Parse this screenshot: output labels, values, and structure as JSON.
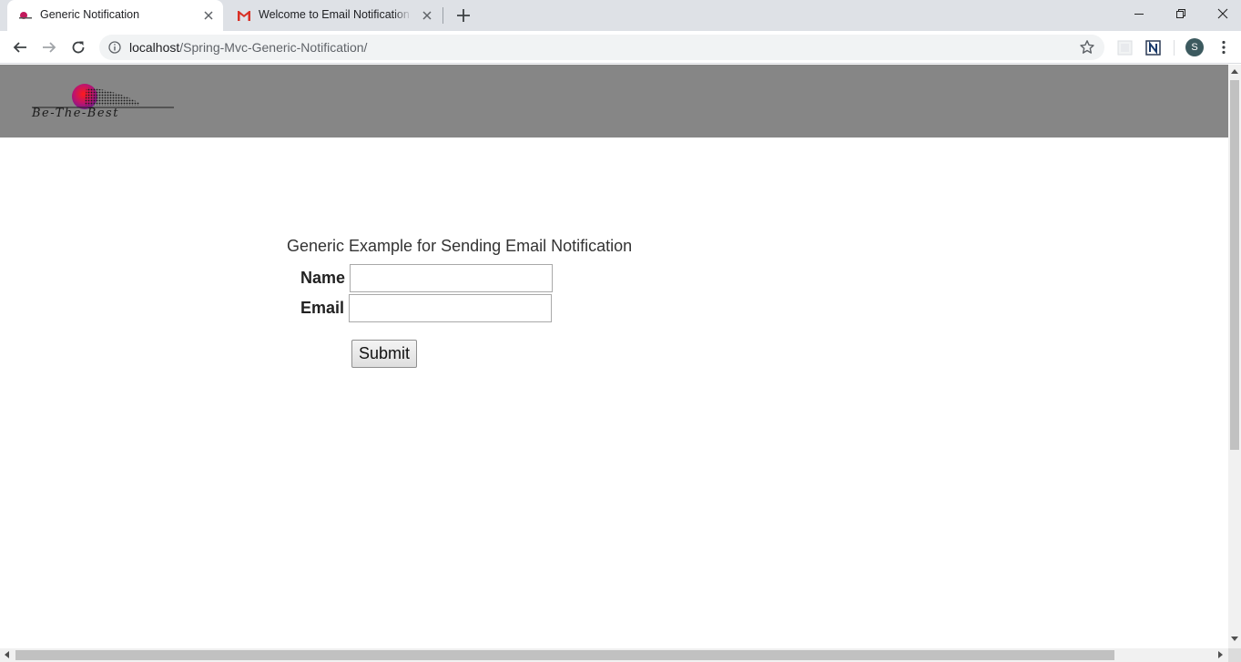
{
  "browser": {
    "tabs": [
      {
        "title": "Generic Notification",
        "active": true,
        "favicon": "sunset-logo-icon"
      },
      {
        "title": "Welcome to Email Notification - s",
        "active": false,
        "favicon": "gmail-icon"
      }
    ],
    "url_host": "localhost",
    "url_path": "/Spring-Mvc-Generic-Notification/",
    "profile_initial": "S"
  },
  "page": {
    "banner_color": "#868686",
    "logo_text": "Be-The-Best",
    "heading": "Generic Example for Sending Email Notification",
    "form": {
      "name_label": "Name",
      "name_value": "",
      "email_label": "Email",
      "email_value": "",
      "submit_label": "Submit"
    }
  }
}
